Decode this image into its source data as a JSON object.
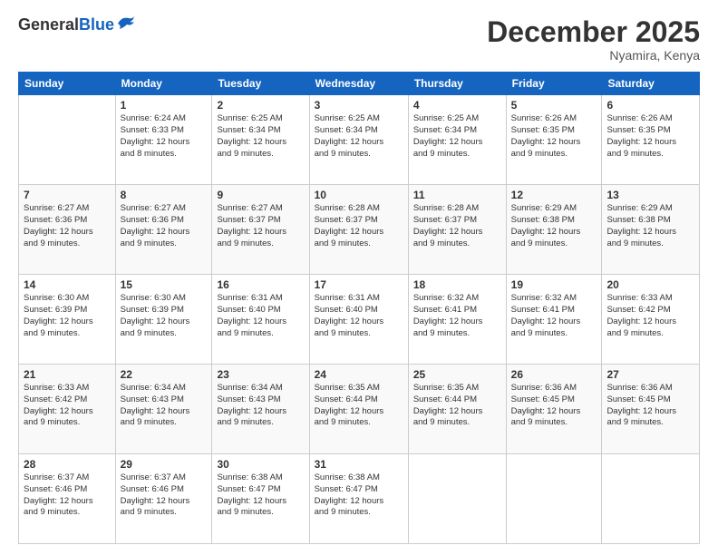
{
  "header": {
    "logo_general": "General",
    "logo_blue": "Blue",
    "month_title": "December 2025",
    "location": "Nyamira, Kenya"
  },
  "days_of_week": [
    "Sunday",
    "Monday",
    "Tuesday",
    "Wednesday",
    "Thursday",
    "Friday",
    "Saturday"
  ],
  "weeks": [
    [
      {
        "day": "",
        "sunrise": "",
        "sunset": "",
        "daylight": ""
      },
      {
        "day": "1",
        "sunrise": "Sunrise: 6:24 AM",
        "sunset": "Sunset: 6:33 PM",
        "daylight": "Daylight: 12 hours and 8 minutes."
      },
      {
        "day": "2",
        "sunrise": "Sunrise: 6:25 AM",
        "sunset": "Sunset: 6:34 PM",
        "daylight": "Daylight: 12 hours and 9 minutes."
      },
      {
        "day": "3",
        "sunrise": "Sunrise: 6:25 AM",
        "sunset": "Sunset: 6:34 PM",
        "daylight": "Daylight: 12 hours and 9 minutes."
      },
      {
        "day": "4",
        "sunrise": "Sunrise: 6:25 AM",
        "sunset": "Sunset: 6:34 PM",
        "daylight": "Daylight: 12 hours and 9 minutes."
      },
      {
        "day": "5",
        "sunrise": "Sunrise: 6:26 AM",
        "sunset": "Sunset: 6:35 PM",
        "daylight": "Daylight: 12 hours and 9 minutes."
      },
      {
        "day": "6",
        "sunrise": "Sunrise: 6:26 AM",
        "sunset": "Sunset: 6:35 PM",
        "daylight": "Daylight: 12 hours and 9 minutes."
      }
    ],
    [
      {
        "day": "7",
        "sunrise": "Sunrise: 6:27 AM",
        "sunset": "Sunset: 6:36 PM",
        "daylight": "Daylight: 12 hours and 9 minutes."
      },
      {
        "day": "8",
        "sunrise": "Sunrise: 6:27 AM",
        "sunset": "Sunset: 6:36 PM",
        "daylight": "Daylight: 12 hours and 9 minutes."
      },
      {
        "day": "9",
        "sunrise": "Sunrise: 6:27 AM",
        "sunset": "Sunset: 6:37 PM",
        "daylight": "Daylight: 12 hours and 9 minutes."
      },
      {
        "day": "10",
        "sunrise": "Sunrise: 6:28 AM",
        "sunset": "Sunset: 6:37 PM",
        "daylight": "Daylight: 12 hours and 9 minutes."
      },
      {
        "day": "11",
        "sunrise": "Sunrise: 6:28 AM",
        "sunset": "Sunset: 6:37 PM",
        "daylight": "Daylight: 12 hours and 9 minutes."
      },
      {
        "day": "12",
        "sunrise": "Sunrise: 6:29 AM",
        "sunset": "Sunset: 6:38 PM",
        "daylight": "Daylight: 12 hours and 9 minutes."
      },
      {
        "day": "13",
        "sunrise": "Sunrise: 6:29 AM",
        "sunset": "Sunset: 6:38 PM",
        "daylight": "Daylight: 12 hours and 9 minutes."
      }
    ],
    [
      {
        "day": "14",
        "sunrise": "Sunrise: 6:30 AM",
        "sunset": "Sunset: 6:39 PM",
        "daylight": "Daylight: 12 hours and 9 minutes."
      },
      {
        "day": "15",
        "sunrise": "Sunrise: 6:30 AM",
        "sunset": "Sunset: 6:39 PM",
        "daylight": "Daylight: 12 hours and 9 minutes."
      },
      {
        "day": "16",
        "sunrise": "Sunrise: 6:31 AM",
        "sunset": "Sunset: 6:40 PM",
        "daylight": "Daylight: 12 hours and 9 minutes."
      },
      {
        "day": "17",
        "sunrise": "Sunrise: 6:31 AM",
        "sunset": "Sunset: 6:40 PM",
        "daylight": "Daylight: 12 hours and 9 minutes."
      },
      {
        "day": "18",
        "sunrise": "Sunrise: 6:32 AM",
        "sunset": "Sunset: 6:41 PM",
        "daylight": "Daylight: 12 hours and 9 minutes."
      },
      {
        "day": "19",
        "sunrise": "Sunrise: 6:32 AM",
        "sunset": "Sunset: 6:41 PM",
        "daylight": "Daylight: 12 hours and 9 minutes."
      },
      {
        "day": "20",
        "sunrise": "Sunrise: 6:33 AM",
        "sunset": "Sunset: 6:42 PM",
        "daylight": "Daylight: 12 hours and 9 minutes."
      }
    ],
    [
      {
        "day": "21",
        "sunrise": "Sunrise: 6:33 AM",
        "sunset": "Sunset: 6:42 PM",
        "daylight": "Daylight: 12 hours and 9 minutes."
      },
      {
        "day": "22",
        "sunrise": "Sunrise: 6:34 AM",
        "sunset": "Sunset: 6:43 PM",
        "daylight": "Daylight: 12 hours and 9 minutes."
      },
      {
        "day": "23",
        "sunrise": "Sunrise: 6:34 AM",
        "sunset": "Sunset: 6:43 PM",
        "daylight": "Daylight: 12 hours and 9 minutes."
      },
      {
        "day": "24",
        "sunrise": "Sunrise: 6:35 AM",
        "sunset": "Sunset: 6:44 PM",
        "daylight": "Daylight: 12 hours and 9 minutes."
      },
      {
        "day": "25",
        "sunrise": "Sunrise: 6:35 AM",
        "sunset": "Sunset: 6:44 PM",
        "daylight": "Daylight: 12 hours and 9 minutes."
      },
      {
        "day": "26",
        "sunrise": "Sunrise: 6:36 AM",
        "sunset": "Sunset: 6:45 PM",
        "daylight": "Daylight: 12 hours and 9 minutes."
      },
      {
        "day": "27",
        "sunrise": "Sunrise: 6:36 AM",
        "sunset": "Sunset: 6:45 PM",
        "daylight": "Daylight: 12 hours and 9 minutes."
      }
    ],
    [
      {
        "day": "28",
        "sunrise": "Sunrise: 6:37 AM",
        "sunset": "Sunset: 6:46 PM",
        "daylight": "Daylight: 12 hours and 9 minutes."
      },
      {
        "day": "29",
        "sunrise": "Sunrise: 6:37 AM",
        "sunset": "Sunset: 6:46 PM",
        "daylight": "Daylight: 12 hours and 9 minutes."
      },
      {
        "day": "30",
        "sunrise": "Sunrise: 6:38 AM",
        "sunset": "Sunset: 6:47 PM",
        "daylight": "Daylight: 12 hours and 9 minutes."
      },
      {
        "day": "31",
        "sunrise": "Sunrise: 6:38 AM",
        "sunset": "Sunset: 6:47 PM",
        "daylight": "Daylight: 12 hours and 9 minutes."
      },
      {
        "day": "",
        "sunrise": "",
        "sunset": "",
        "daylight": ""
      },
      {
        "day": "",
        "sunrise": "",
        "sunset": "",
        "daylight": ""
      },
      {
        "day": "",
        "sunrise": "",
        "sunset": "",
        "daylight": ""
      }
    ]
  ]
}
